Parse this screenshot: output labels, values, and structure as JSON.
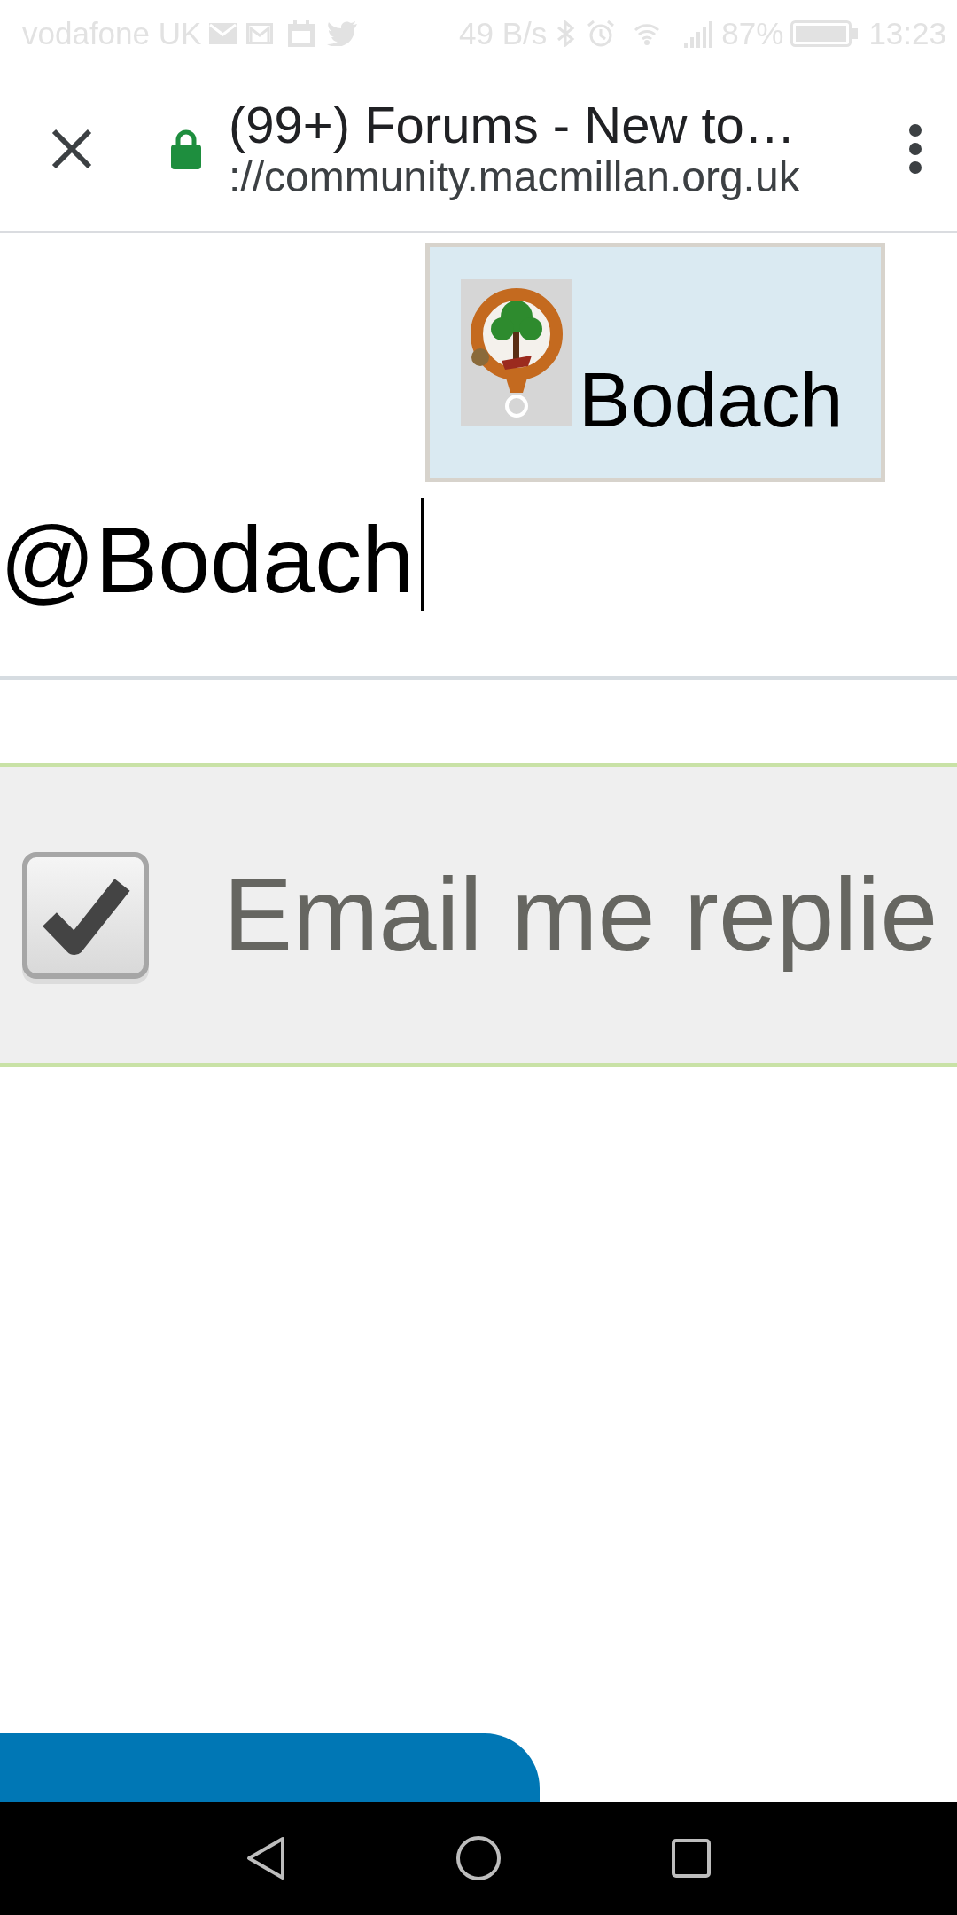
{
  "status_bar": {
    "carrier": "vodafone UK",
    "network_speed": "49 B/s",
    "battery": "87%",
    "time": "13:23"
  },
  "browser_bar": {
    "page_title": "(99+) Forums - New to…",
    "url": "://community.macmillan.org.uk"
  },
  "editor": {
    "value": "@Bodach"
  },
  "mention_suggestions": [
    {
      "name": "Bodach",
      "selected": true
    }
  ],
  "email_replies": {
    "label": "Email me replie",
    "checked": true
  }
}
